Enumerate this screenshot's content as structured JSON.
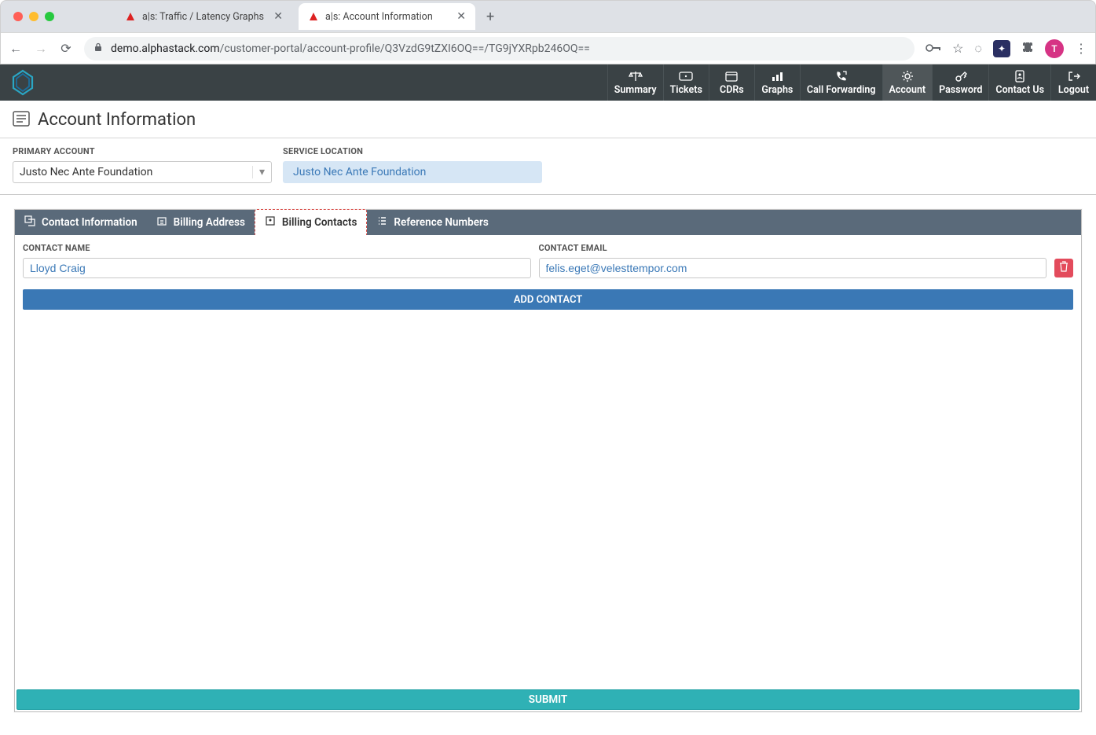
{
  "browser": {
    "tabs": [
      {
        "title": "a|s: Traffic / Latency Graphs",
        "active": false
      },
      {
        "title": "a|s: Account Information",
        "active": true
      }
    ],
    "url_domain": "demo.alphastack.com",
    "url_path": "/customer-portal/account-profile/Q3VzdG9tZXI6OQ==/TG9jYXRpb246OQ==",
    "avatar_initial": "T"
  },
  "nav": {
    "items": [
      {
        "label": "Summary",
        "icon": "balance-icon"
      },
      {
        "label": "Tickets",
        "icon": "ticket-icon"
      },
      {
        "label": "CDRs",
        "icon": "calendar-icon"
      },
      {
        "label": "Graphs",
        "icon": "chart-icon"
      },
      {
        "label": "Call Forwarding",
        "icon": "phone-icon"
      },
      {
        "label": "Account",
        "icon": "gear-icon",
        "active": true
      },
      {
        "label": "Password",
        "icon": "key-icon"
      },
      {
        "label": "Contact Us",
        "icon": "contact-icon"
      },
      {
        "label": "Logout",
        "icon": "logout-icon"
      }
    ]
  },
  "page": {
    "title": "Account Information",
    "primary_account_label": "PRIMARY ACCOUNT",
    "primary_account_value": "Justo Nec Ante Foundation",
    "service_location_label": "SERVICE LOCATION",
    "service_location_value": "Justo Nec Ante Foundation"
  },
  "panel": {
    "tabs": [
      {
        "label": "Contact Information"
      },
      {
        "label": "Billing Address"
      },
      {
        "label": "Billing Contacts",
        "active": true
      },
      {
        "label": "Reference Numbers"
      }
    ],
    "contact_name_label": "CONTACT NAME",
    "contact_email_label": "CONTACT EMAIL",
    "contacts": [
      {
        "name": "Lloyd Craig",
        "email": "felis.eget@velesttempor.com"
      }
    ],
    "add_contact_label": "ADD CONTACT",
    "submit_label": "SUBMIT"
  }
}
